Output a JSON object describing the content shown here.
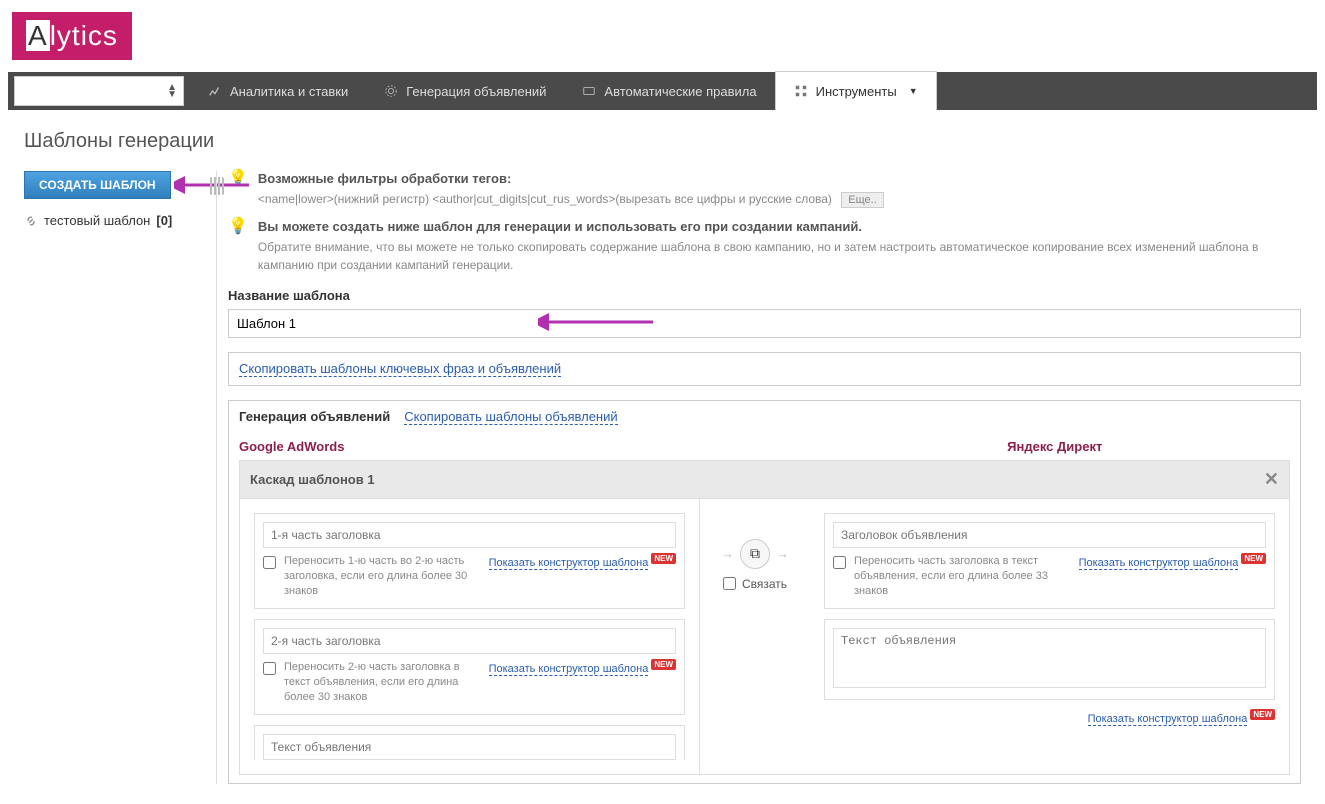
{
  "logo": "Alytics",
  "nav": {
    "analytics": "Аналитика и ставки",
    "generation": "Генерация объявлений",
    "rules": "Автоматические правила",
    "tools": "Инструменты"
  },
  "page_title": "Шаблоны генерации",
  "sidebar": {
    "create_btn": "СОЗДАТЬ ШАБЛОН",
    "item_label": "тестовый шаблон",
    "item_count": "[0]"
  },
  "hints": {
    "filters_title": "Возможные фильтры обработки тегов:",
    "filters_body": "<name|lower>(нижний регистр)   <author|cut_digits|cut_rus_words>(вырезать все цифры и русские слова)",
    "more": "Еще..",
    "create_title": "Вы можете создать ниже шаблон для генерации и использовать его при создании кампаний.",
    "create_body": "Обратите внимание, что вы можете не только скопировать содержание шаблона в свою кампанию, но и затем настроить автоматическое копирование всех изменений шаблона в кампанию при создании кампаний генерации."
  },
  "fields": {
    "name_label": "Название шаблона",
    "name_value": "Шаблон 1",
    "copy_keywords": "Скопировать шаблоны ключевых фраз и объявлений"
  },
  "gen_panel": {
    "title": "Генерация объявлений",
    "copy_ad_templates": "Скопировать шаблоны объявлений",
    "google": "Google AdWords",
    "yandex": "Яндекс Директ",
    "cascade": "Каскад шаблонов 1",
    "link_label": "Связать"
  },
  "google_ads": {
    "h1_placeholder": "1-я часть заголовка",
    "h1_check": "Переносить 1-ю часть во 2-ю часть заголовка, если его длина более 30 знаков",
    "h2_placeholder": "2-я часть заголовка",
    "h2_check": "Переносить 2-ю часть заголовка в текст объявления, если его длина более 30 знаков",
    "text_placeholder": "Текст объявления",
    "show_constructor": "Показать конструктор шаблона",
    "new_badge": "NEW"
  },
  "yandex_ads": {
    "h_placeholder": "Заголовок объявления",
    "h_check": "Переносить часть заголовка в текст объявления, если его длина более 33 знаков",
    "text_placeholder": "Текст объявления",
    "show_constructor": "Показать конструктор шаблона",
    "new_badge": "NEW"
  }
}
